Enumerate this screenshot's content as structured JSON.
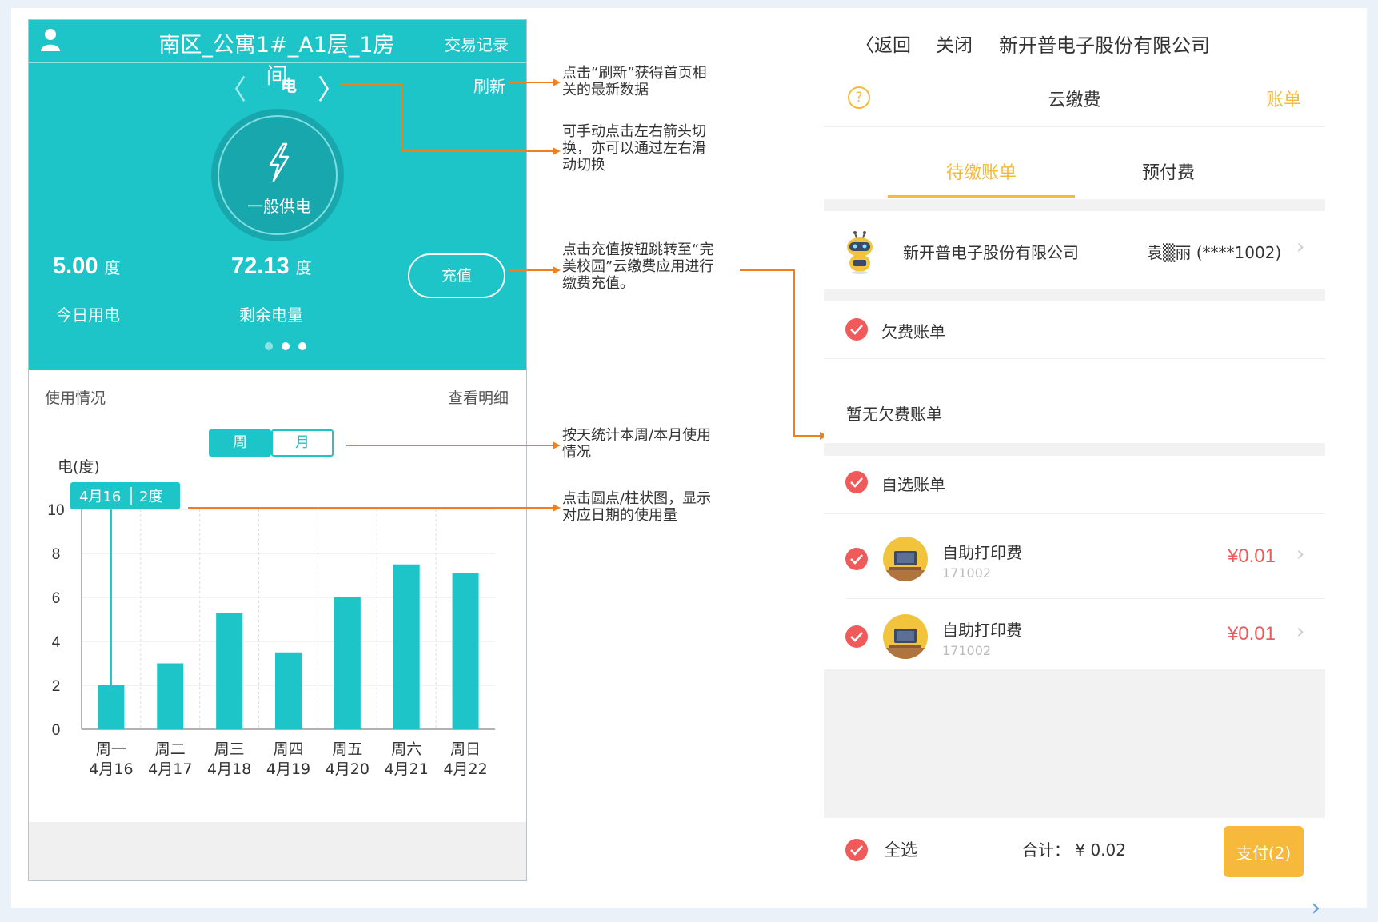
{
  "left_phone": {
    "room_title": "南区_公寓1#_A1层_1房间",
    "transactions_link": "交易记录",
    "nav": {
      "prev": "〈",
      "type": "电",
      "next": "〉",
      "refresh": "刷新"
    },
    "dial_label": "一般供电",
    "today_usage": {
      "value": "5.00",
      "unit": "度",
      "label": "今日用电"
    },
    "remaining": {
      "value": "72.13",
      "unit": "度",
      "label": "剩余电量"
    },
    "recharge_button": "充值",
    "usage_section_title": "使用情况",
    "detail_link": "查看明细",
    "segment": {
      "week": "周",
      "month": "月"
    },
    "y_unit_label": "电(度)",
    "tooltip": {
      "date": "4月16",
      "value": "2度"
    }
  },
  "chart_data": {
    "type": "bar",
    "categories": [
      "周一 4月16",
      "周二 4月17",
      "周三 4月18",
      "周四 4月19",
      "周五 4月20",
      "周六 4月21",
      "周日 4月22"
    ],
    "weekday_labels": [
      "周一",
      "周二",
      "周三",
      "周四",
      "周五",
      "周六",
      "周日"
    ],
    "date_labels": [
      "4月16",
      "4月17",
      "4月18",
      "4月19",
      "4月20",
      "4月21",
      "4月22"
    ],
    "values": [
      2,
      3,
      5.3,
      3.5,
      6,
      7.5,
      7.1
    ],
    "ylabel": "电(度)",
    "ylim": [
      0,
      10
    ],
    "yticks": [
      0,
      2,
      4,
      6,
      8,
      10
    ],
    "selected_index": 0,
    "grid": true,
    "bar_color": "#1ec5c8"
  },
  "annotations": {
    "refresh": [
      "点击“刷新”获得首页相",
      "关的最新数据"
    ],
    "switch": [
      "可手动点击左右箭头切",
      "换，亦可以通过左右滑",
      "动切换"
    ],
    "recharge": [
      "点击充值按钮跳转至“完",
      "美校园”云缴费应用进行",
      "缴费充值。"
    ],
    "period": [
      "按天统计本周/本月使用",
      "情况"
    ],
    "tap": [
      "点击圆点/柱状图，显示",
      "对应日期的使用量"
    ]
  },
  "right_phone": {
    "back": "〈返回",
    "close": "关闭",
    "company_title": "新开普电子股份有限公司",
    "help": "?",
    "page_title": "云缴费",
    "bill_link": "账单",
    "tabs": {
      "pending": "待缴账单",
      "prepay": "预付费"
    },
    "merchant": {
      "name": "新开普电子股份有限公司",
      "payer": "袁▒丽 (****1002)"
    },
    "owed_section": "欠费账单",
    "no_owed": "暂无欠费账单",
    "optional_section": "自选账单",
    "bills": [
      {
        "title": "自助打印费",
        "code": "171002",
        "amount": "¥0.01"
      },
      {
        "title": "自助打印费",
        "code": "171002",
        "amount": "¥0.01"
      }
    ],
    "footer": {
      "select_all": "全选",
      "total": "合计：  ¥ 0.02",
      "pay": "支付(2)"
    }
  },
  "colors": {
    "teal": "#1ec5c8",
    "accent": "#f6b93b",
    "red": "#f15a5a",
    "arrow": "#f07f1e"
  },
  "icons": [
    "user-icon",
    "bolt-icon",
    "robot-icon",
    "check-icon",
    "laptop-icon",
    "help-icon",
    "chevron-right-icon"
  ]
}
